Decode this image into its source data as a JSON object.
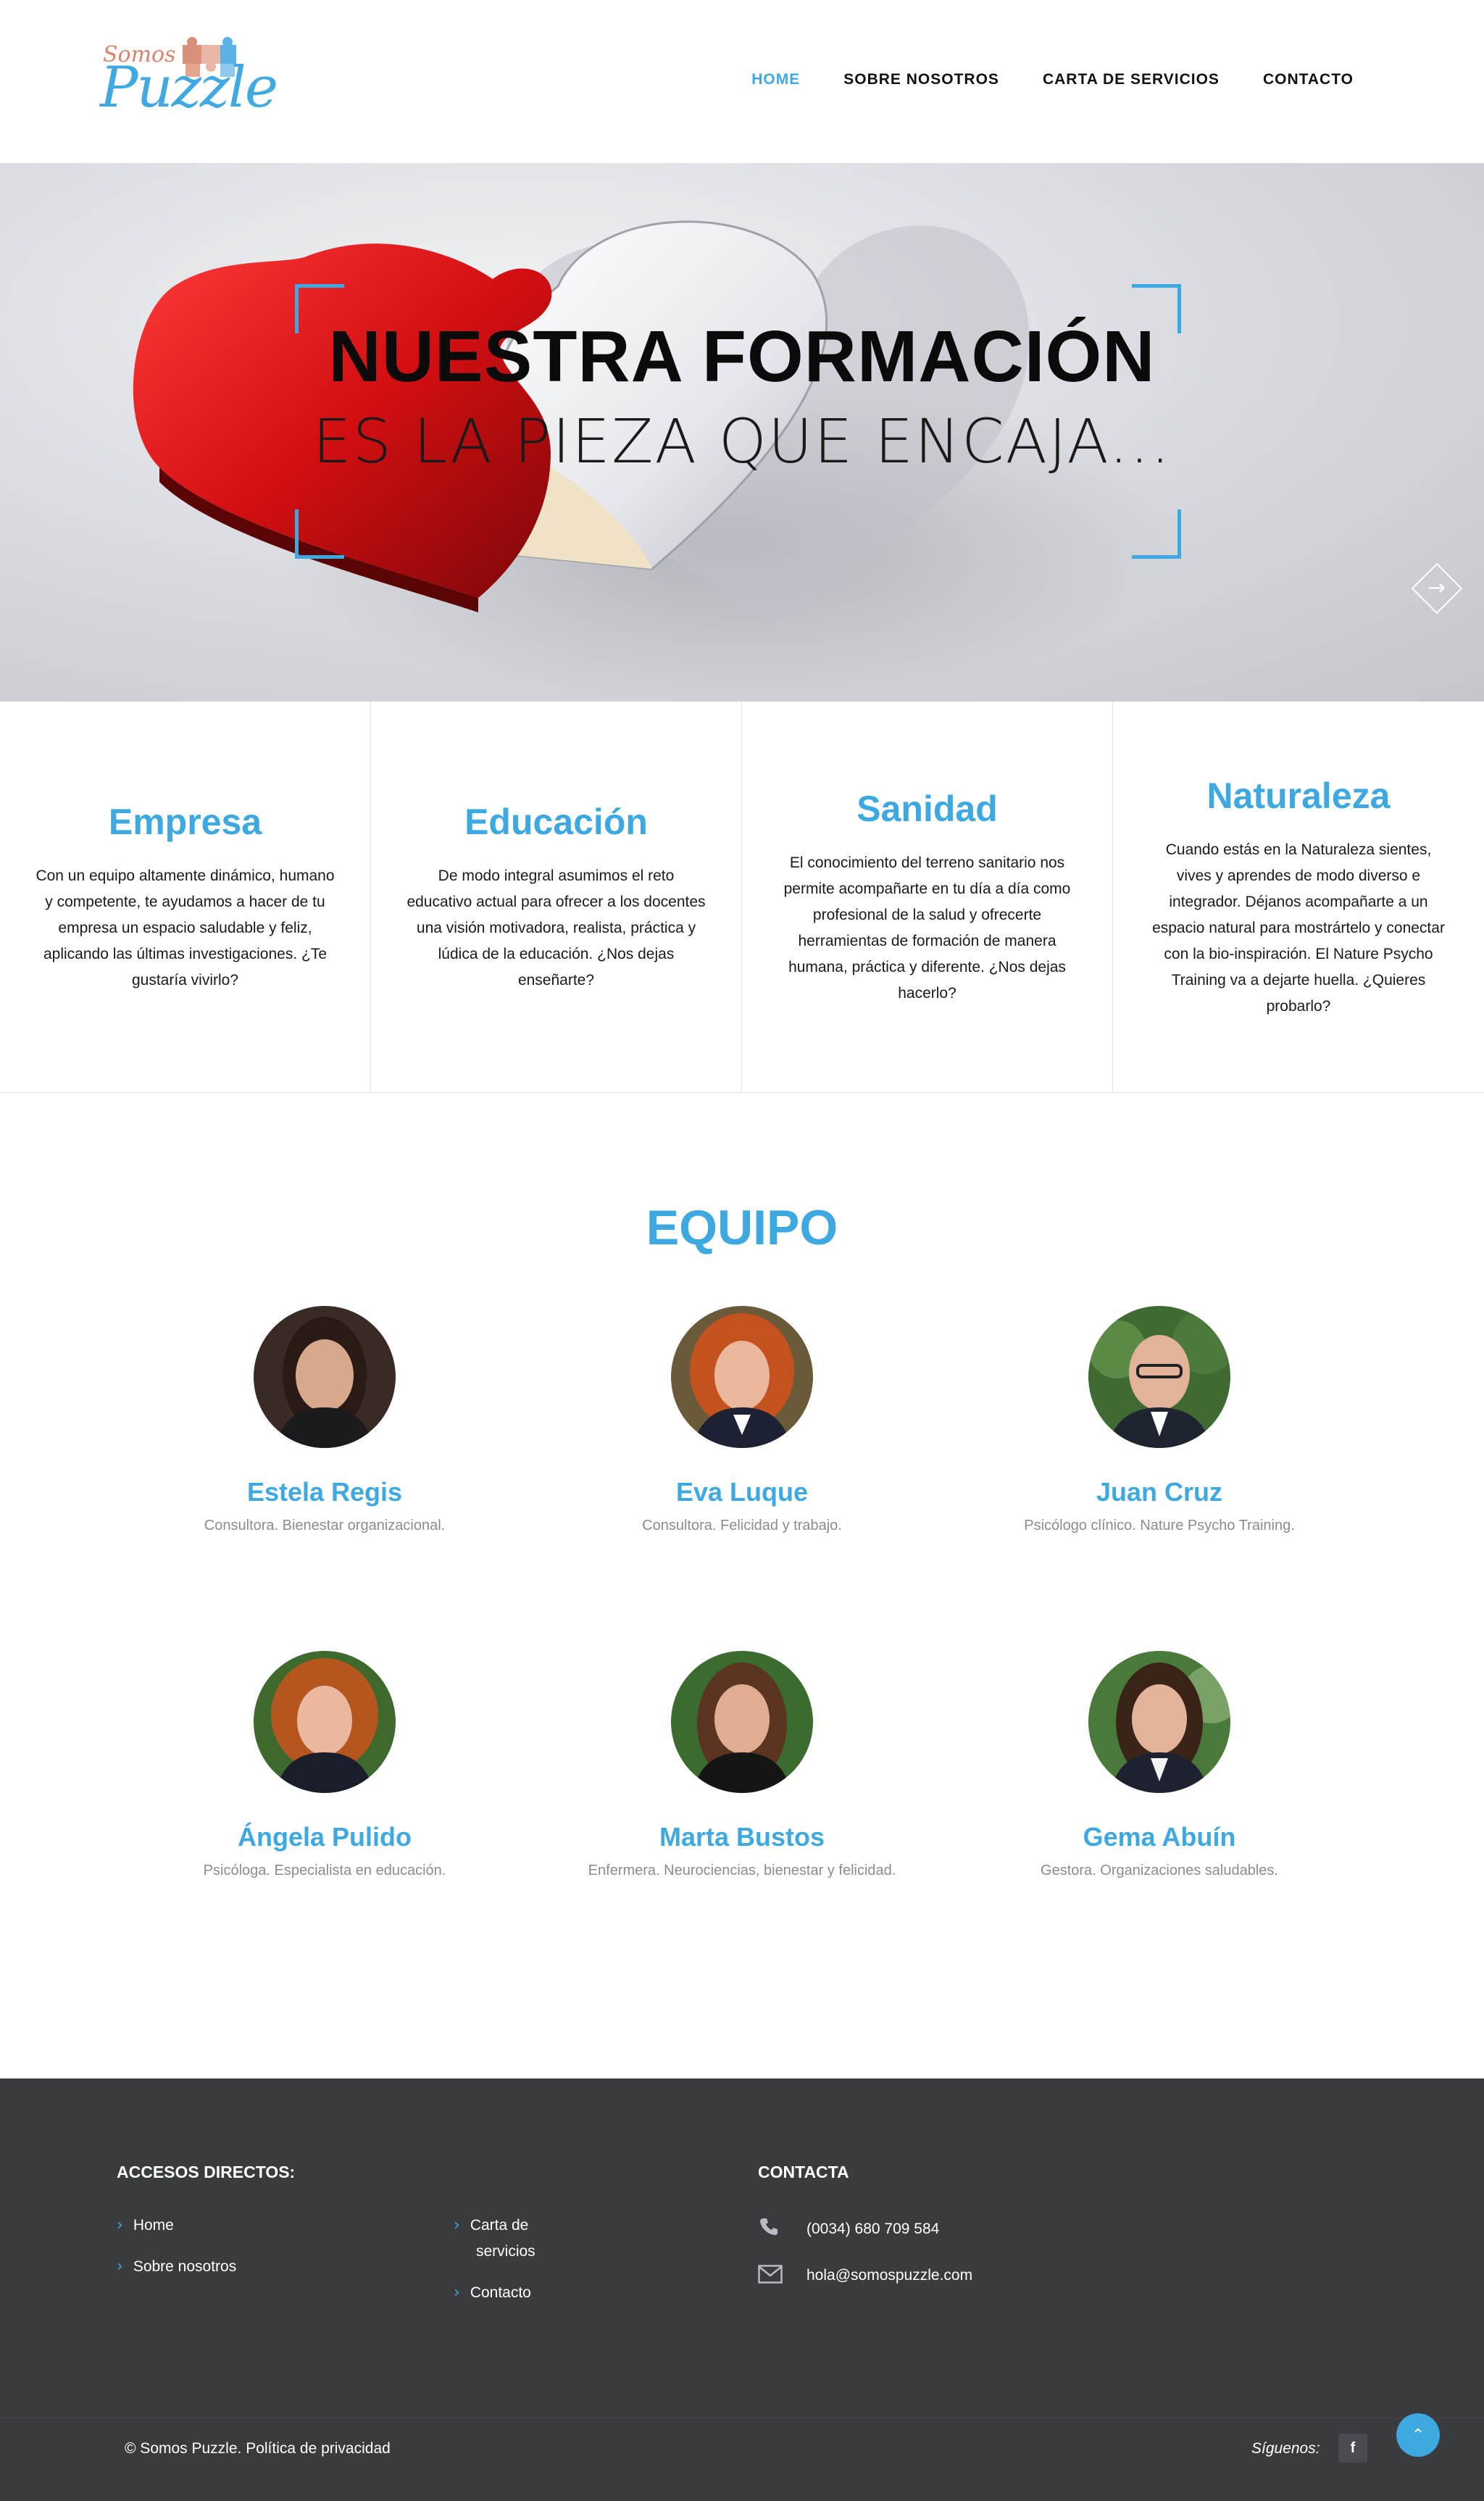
{
  "brand": {
    "logo_small": "Somos",
    "logo_main": "Puzzle",
    "accent_color": "#3ea8e0"
  },
  "nav": {
    "items": [
      {
        "label": "HOME",
        "active": true
      },
      {
        "label": "SOBRE NOSOTROS",
        "active": false
      },
      {
        "label": "CARTA DE SERVICIOS",
        "active": false
      },
      {
        "label": "CONTACTO",
        "active": false
      }
    ]
  },
  "hero": {
    "title": "NUESTRA FORMACIÓN",
    "subtitle": "ES LA PIEZA QUE ENCAJA...",
    "next_icon": "arrow-right-icon"
  },
  "services": [
    {
      "title": "Empresa",
      "text": "Con un equipo altamente dinámico, humano y competente, te ayudamos a hacer de tu empresa un espacio saludable y feliz, aplicando las últimas investigaciones. ¿Te gustaría vivirlo?"
    },
    {
      "title": "Educación",
      "text": "De modo integral asumimos el reto educativo actual para ofrecer a los docentes una visión motivadora, realista, práctica y lúdica de la educación. ¿Nos dejas enseñarte?"
    },
    {
      "title": "Sanidad",
      "text": "El conocimiento del terreno sanitario nos permite acompañarte en tu día a día como profesional de la salud y ofrecerte herramientas de formación de manera humana, práctica y diferente. ¿Nos dejas hacerlo?"
    },
    {
      "title": "Naturaleza",
      "text": "Cuando estás en la Naturaleza sientes, vives y aprendes de modo diverso e integrador. Déjanos acompañarte a un espacio natural para mostrártelo y conectar con la bio-inspiración. El Nature Psycho Training va a dejarte huella. ¿Quieres probarlo?"
    }
  ],
  "team": {
    "title": "EQUIPO",
    "members": [
      {
        "name": "Estela Regis",
        "role": "Consultora. Bienestar organizacional."
      },
      {
        "name": "Eva Luque",
        "role": "Consultora. Felicidad y trabajo."
      },
      {
        "name": "Juan Cruz",
        "role": "Psicólogo clínico. Nature Psycho Training."
      },
      {
        "name": "Ángela Pulido",
        "role": "Psicóloga. Especialista en educación."
      },
      {
        "name": "Marta Bustos",
        "role": "Enfermera. Neurociencias, bienestar y felicidad."
      },
      {
        "name": "Gema Abuín",
        "role": "Gestora. Organizaciones saludables."
      }
    ]
  },
  "footer": {
    "shortcuts_title": "ACCESOS DIRECTOS:",
    "links_col1": [
      "Home",
      "Sobre nosotros"
    ],
    "links_col2_line1": "Carta de",
    "links_col2_line2": "servicios",
    "links_col2_contact": "Contacto",
    "contact_title": "CONTACTA",
    "phone": "(0034) 680 709 584",
    "email": "hola@somospuzzle.com",
    "copyright": "©  Somos Puzzle.  Política de privacidad",
    "follow": "Síguenos:",
    "social": "f",
    "background_color": "#3a3b3f"
  }
}
